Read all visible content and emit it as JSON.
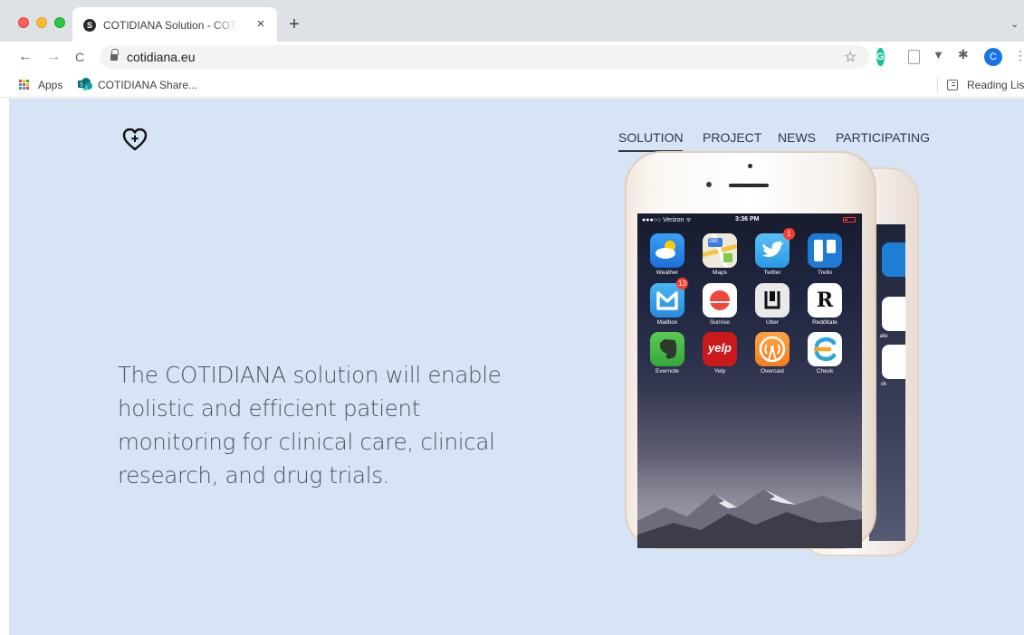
{
  "browser": {
    "tab": {
      "favicon_letter": "S",
      "title": "COTIDIANA Solution - COTIDIANA"
    },
    "close_tab_glyph": "×",
    "new_tab_glyph": "+",
    "tab_menu_glyph": "⌄",
    "nav": {
      "back": "←",
      "forward": "→",
      "reload": "C"
    },
    "url": "cotidiana.eu",
    "star_glyph": "☆",
    "extensions": {
      "grammarly": "G",
      "avatar_letter": "C",
      "kebab": "⋮",
      "vivaldi": "▼",
      "puzzle": "✱"
    },
    "bookmarks": {
      "apps_label": "Apps",
      "share_label": "COTIDIANA Share...",
      "reading_list_label": "Reading List"
    }
  },
  "site": {
    "nav_items": [
      "SOLUTION",
      "PROJECT",
      "NEWS",
      "PARTICIPATING"
    ],
    "active_nav": "SOLUTION",
    "hero_text": "The COTIDIANA solution will enable holistic and efficient patient monitoring for clinical care, clinical research, and drug trials."
  },
  "phone": {
    "carrier": "●●●○○ Verizon ᯤ",
    "time": "3:36 PM",
    "apps": [
      {
        "label": "Weather",
        "badge": ""
      },
      {
        "label": "Maps",
        "badge": ""
      },
      {
        "label": "Twitter",
        "badge": "1"
      },
      {
        "label": "Trello",
        "badge": ""
      },
      {
        "label": "Mailbox",
        "badge": "13"
      },
      {
        "label": "Sunrise",
        "badge": ""
      },
      {
        "label": "Uber",
        "badge": ""
      },
      {
        "label": "Redditate",
        "badge": ""
      },
      {
        "label": "Evernote",
        "badge": ""
      },
      {
        "label": "Yelp",
        "badge": ""
      },
      {
        "label": "Overcast",
        "badge": ""
      },
      {
        "label": "Check",
        "badge": ""
      }
    ],
    "app_glyphs": {
      "maps": "280",
      "redditate": "R",
      "yelp": "yelp"
    },
    "back_phone_labels": [
      "ate",
      "ck"
    ]
  },
  "colors": {
    "page_bg": "#d6e4f5",
    "nav_text": "#2b3a4a",
    "hero_text": "#4a5560",
    "badge": "#ff3b30"
  }
}
